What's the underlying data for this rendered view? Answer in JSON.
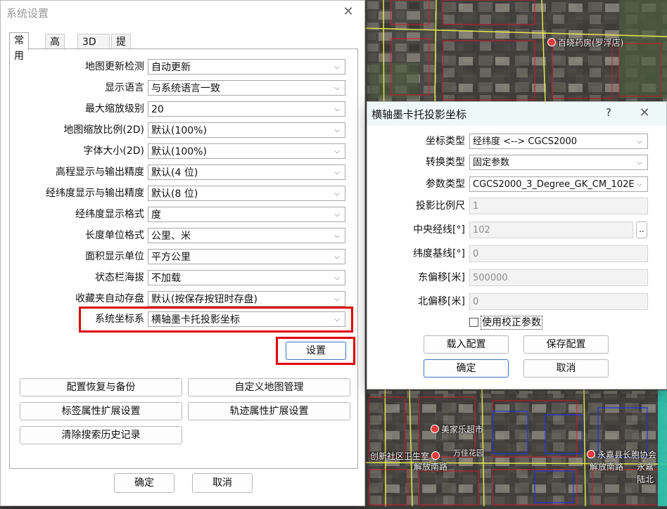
{
  "map": {
    "labels": {
      "pharmacy": "百晓药房(罗浮店)",
      "supermarket": "美家乐超市",
      "clinic": "创新社区卫生室",
      "road_left": "解放南路",
      "road_right": "解放南路",
      "district_office": "永嘉县长胞协会",
      "tiny_label": "万佳花园",
      "corner_a": "永嘉",
      "corner_b": "陆北"
    }
  },
  "settings": {
    "title": "系统设置",
    "tabs": [
      "常用",
      "高级",
      "3D",
      "提醒"
    ],
    "rows": [
      {
        "label": "地图更新检测",
        "value": "自动更新"
      },
      {
        "label": "显示语言",
        "value": "与系统语言一致"
      },
      {
        "label": "最大缩放级别",
        "value": "20"
      },
      {
        "label": "地图缩放比例(2D)",
        "value": "默认(100%)"
      },
      {
        "label": "字体大小(2D)",
        "value": "默认(100%)"
      },
      {
        "label": "高程显示与输出精度",
        "value": "默认(4 位)"
      },
      {
        "label": "经纬度显示与输出精度",
        "value": "默认(8 位)"
      },
      {
        "label": "经纬度显示格式",
        "value": "度"
      },
      {
        "label": "长度单位格式",
        "value": "公里、米"
      },
      {
        "label": "面积显示单位",
        "value": "平方公里"
      },
      {
        "label": "状态栏海拔",
        "value": "不加载"
      },
      {
        "label": "收藏夹自动存盘",
        "value": "默认(按保存按钮时存盘)"
      },
      {
        "label": "系统坐标系",
        "value": "横轴墨卡托投影坐标"
      }
    ],
    "setup_button": "设置",
    "buttons": {
      "restore_backup": "配置恢复与备份",
      "custom_map": "自定义地图管理",
      "label_ext": "标签属性扩展设置",
      "track_ext": "轨迹属性扩展设置",
      "clear_history": "清除搜索历史记录"
    },
    "ok": "确定",
    "cancel": "取消"
  },
  "projection": {
    "title": "横轴墨卡托投影坐标",
    "help": "?",
    "coord_type_label": "坐标类型",
    "coord_type_value": "经纬度 <--> CGCS2000",
    "transform_type_label": "转换类型",
    "transform_type_value": "固定参数",
    "param_type_label": "参数类型",
    "param_type_value": "CGCS2000_3_Degree_GK_CM_102E",
    "scale_label": "投影比例尺",
    "scale_value": "1",
    "central_meridian_label": "中央经线[°]",
    "central_meridian_value": "102",
    "more_button": "..",
    "latitude_base_label": "纬度基线[°]",
    "latitude_base_value": "0",
    "false_easting_label": "东偏移[米]",
    "false_easting_value": "500000",
    "false_northing_label": "北偏移[米]",
    "false_northing_value": "0",
    "use_correction_label": "使用校正参数",
    "load_config": "载入配置",
    "save_config": "保存配置",
    "ok": "确定",
    "cancel": "取消"
  },
  "colors": {
    "highlight_red": "#e00000",
    "primary_border": "#3a73c9",
    "road_yellow": "#e8e84a",
    "boundary_red": "#d11a2a",
    "boundary_blue": "#2233dd"
  }
}
